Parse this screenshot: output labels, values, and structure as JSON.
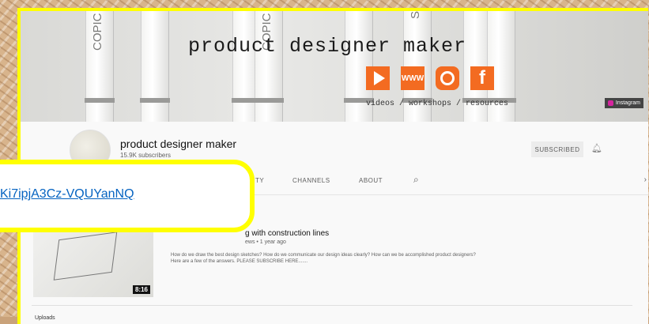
{
  "banner": {
    "title": "product designer maker",
    "tagline": "videos / workshops / resources",
    "www_label": "WWW",
    "fb_label": "f",
    "instagram_link": "Instagram",
    "marker_brand": "COPIC",
    "marker_brand_2": "Sharpie"
  },
  "channel": {
    "name": "product designer maker",
    "subscribers": "15.9K subscribers",
    "subscribe_label": "SUBSCRIBED"
  },
  "tabs": {
    "community_partial": "NITY",
    "channels": "CHANNELS",
    "about": "ABOUT"
  },
  "video": {
    "title_partial": "g with construction lines",
    "meta_partial": "ews • 1 year ago",
    "description_partial": "How do we draw the best design sketches? How do we communicate our design ideas clearly? How can we be accomplished product designers? Here are a few of the answers. PLEASE SUBSCRIBE HERE.......",
    "duration": "8:16"
  },
  "bottom_label_partial": "Uploads",
  "callout": {
    "link_text": "Ki7ipjA3Cz-VQUYanNQ"
  },
  "colors": {
    "highlight": "#ffff00",
    "accent_orange": "#f36b21",
    "link_blue": "#0563c1"
  }
}
